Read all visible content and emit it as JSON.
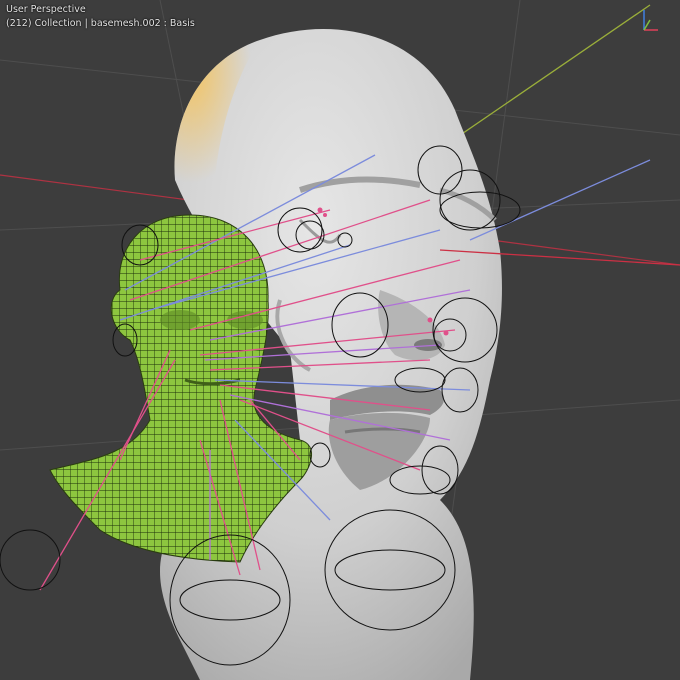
{
  "viewport": {
    "view_name": "User Perspective",
    "collection_info": "(212) Collection | basemesh.002 : Basis"
  },
  "colors": {
    "background": "#3d3d3d",
    "grid_line": "#4e4e4e",
    "sculpt_gray": "#cfcfcf",
    "sculpt_highlight": "#f0c060",
    "basemesh_green": "#8dc63f",
    "wire_dark": "#1a2a0a",
    "bone_circle": "#111111",
    "line_pink": "#e0508a",
    "line_blue": "#7c8cdc",
    "line_purple": "#b070d8",
    "axis_yellowgreen": "#9aae3a",
    "axis_red": "#cc3044"
  },
  "gizmo": {
    "x_axis_color": "#e0405a",
    "y_axis_color": "#80c040",
    "z_axis_color": "#4080e0"
  }
}
